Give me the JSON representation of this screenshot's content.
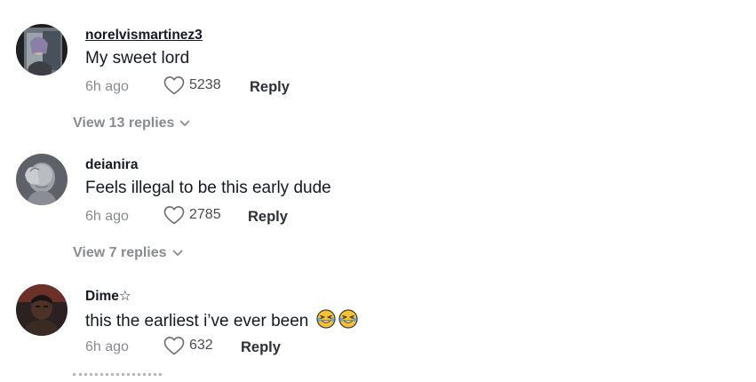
{
  "comments": [
    {
      "username": "norelvismartinez3",
      "text": "My sweet lord",
      "time": "6h ago",
      "likes": "5238",
      "reply_label": "Reply",
      "view_replies": "View 13 replies",
      "avatar": "person-avatar",
      "username_underlined": true
    },
    {
      "username": "deianira",
      "text": "Feels illegal to be this early dude",
      "time": "6h ago",
      "likes": "2785",
      "reply_label": "Reply",
      "view_replies": "View 7 replies",
      "avatar": "facepalm-statue-avatar"
    },
    {
      "username": "Dime☆",
      "text": "this the earliest i’ve ever been",
      "emojis": [
        "grinning-squinting-tears-emoji",
        "grinning-squinting-tears-emoji"
      ],
      "time": "6h ago",
      "likes": "632",
      "reply_label": "Reply",
      "avatar": "dark-person-avatar"
    }
  ],
  "icons": {
    "like": "heart-outline-icon",
    "expand": "chevron-down-icon"
  },
  "colors": {
    "primary_text": "#161823",
    "secondary_text": "#8a8b91",
    "like_count": "#4a4b55"
  }
}
